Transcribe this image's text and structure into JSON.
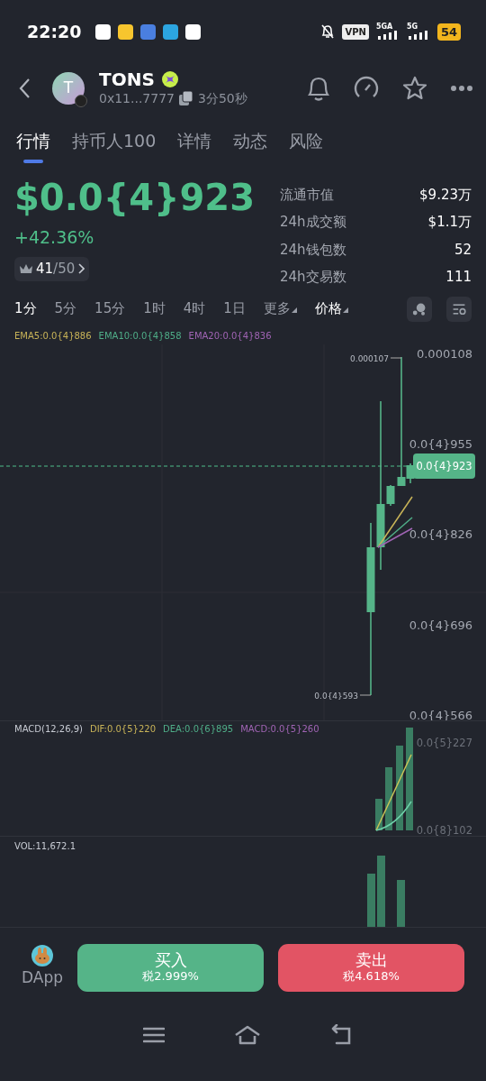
{
  "status_bar": {
    "time": "22:20",
    "network_1": "5GA",
    "network_2": "5G",
    "vpn": "VPN",
    "battery": "54"
  },
  "header": {
    "title": "TONS",
    "avatar_letter": "T",
    "address": "0x11...7777",
    "age": "3分50秒"
  },
  "tabs": [
    {
      "label": "行情",
      "selected": true
    },
    {
      "label": "持币人100",
      "selected": false
    },
    {
      "label": "详情",
      "selected": false
    },
    {
      "label": "动态",
      "selected": false
    },
    {
      "label": "风险",
      "selected": false
    }
  ],
  "price": {
    "value": "$0.0{4}923",
    "change": "+42.36%",
    "rank": "41",
    "rank_total": "/50"
  },
  "stats": [
    {
      "label": "流通市值",
      "value": "$9.23万"
    },
    {
      "label": "24h成交额",
      "value": "$1.1万"
    },
    {
      "label": "24h钱包数",
      "value": "52"
    },
    {
      "label": "24h交易数",
      "value": "111"
    }
  ],
  "timeframes": [
    {
      "label": "1分",
      "selected": true,
      "kind": "interval"
    },
    {
      "label": "5分",
      "selected": false,
      "kind": "interval"
    },
    {
      "label": "15分",
      "selected": false,
      "kind": "interval"
    },
    {
      "label": "1时",
      "selected": false,
      "kind": "interval"
    },
    {
      "label": "4时",
      "selected": false,
      "kind": "interval"
    },
    {
      "label": "1日",
      "selected": false,
      "kind": "interval"
    },
    {
      "label": "更多",
      "selected": false,
      "kind": "dropdown"
    }
  ],
  "price_mode": "价格",
  "ema": [
    {
      "label": "EMA5:0.0{4}886",
      "color": "#c9b458"
    },
    {
      "label": "EMA10:0.0{4}858",
      "color": "#4fae88"
    },
    {
      "label": "EMA20:0.0{4}836",
      "color": "#a064b4"
    }
  ],
  "main_chart": {
    "y_labels": [
      "0.000108",
      "0.0{4}955",
      "0.0{4}826",
      "0.0{4}696",
      "0.0{4}566"
    ],
    "high_label": "0.000107",
    "low_label": "0.0{4}593",
    "current_price": "0.0{4}923"
  },
  "macd": {
    "labels": [
      {
        "label": "MACD(12,26,9)",
        "color": "#c8ccd4"
      },
      {
        "label": "DIF:0.0{5}220",
        "color": "#c9b458"
      },
      {
        "label": "DEA:0.0{6}895",
        "color": "#4fae88"
      },
      {
        "label": "MACD:0.0{5}260",
        "color": "#a064b4"
      }
    ],
    "y_labels": [
      "0.0{5}227",
      "0.0{8}102"
    ]
  },
  "volume": {
    "label": "VOL:11,672.1"
  },
  "actions": {
    "dapp": "DApp",
    "buy": {
      "label": "买入",
      "tax": "税2.999%"
    },
    "sell": {
      "label": "卖出",
      "tax": "税4.618%"
    }
  }
}
